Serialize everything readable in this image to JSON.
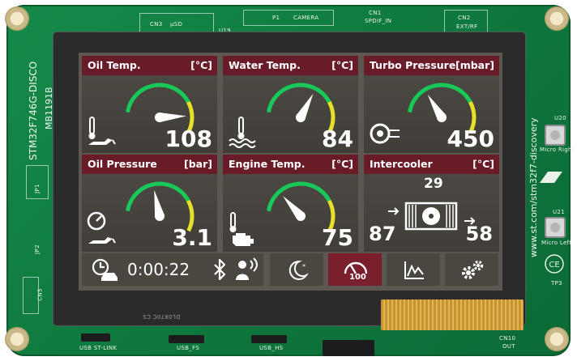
{
  "board": {
    "silk_cn3": "CN3",
    "silk_usd": "µSD",
    "silk_u19": "U19",
    "silk_p1": "P1",
    "silk_camera": "CAMERA",
    "silk_cn1": "CN1",
    "silk_spdif": "SPDIF_IN",
    "silk_cn2": "CN2",
    "silk_ext": "EXT/RF",
    "model": "STM32F746G-DISCO",
    "code": "MB1191B",
    "url": "www.st.com/stm32f7-discovery",
    "silk_u20": "U20",
    "micro_right": "Micro Right",
    "silk_u21": "U21",
    "micro_left": "Micro Left",
    "silk_tp3": "TP3",
    "silk_jp1": "JP1",
    "silk_jp2": "JP2",
    "silk_cn5": "CN5",
    "silk_usb_stlink": "USB ST-LINK",
    "silk_usb_fs": "USB_FS",
    "silk_usb_hs": "USB_HS",
    "silk_cn10": "CN10",
    "silk_out": "OUT",
    "lcd_label": "DL0870C CS"
  },
  "panels": [
    {
      "title": "Oil Temp.",
      "unit": "[°C]",
      "value": "108",
      "fill": 0.85,
      "icon": "oil-temperature-icon"
    },
    {
      "title": "Water Temp.",
      "unit": "[°C]",
      "value": "84",
      "fill": 0.55,
      "icon": "water-temperature-icon"
    },
    {
      "title": "Turbo Pressure",
      "unit": "[mbar]",
      "value": "450",
      "fill": 0.25,
      "icon": "turbo-icon"
    },
    {
      "title": "Oil Pressure",
      "unit": "[bar]",
      "value": "3.1",
      "fill": 0.35,
      "icon": "oil-pressure-icon"
    },
    {
      "title": "Engine Temp.",
      "unit": "[°C]",
      "value": "75",
      "fill": 0.2,
      "icon": "engine-temperature-icon"
    },
    {
      "title": "Intercooler",
      "unit": "[°C]",
      "icon": "intercooler-icon"
    }
  ],
  "intercooler": {
    "top": "29",
    "in": "87",
    "out": "58"
  },
  "toolbar": {
    "timer": "0:00:22",
    "speed_badge": "100"
  },
  "colors": {
    "accent": "#6a1b28",
    "gauge_green": "#18c95a",
    "gauge_yellow": "#e6e02a"
  }
}
